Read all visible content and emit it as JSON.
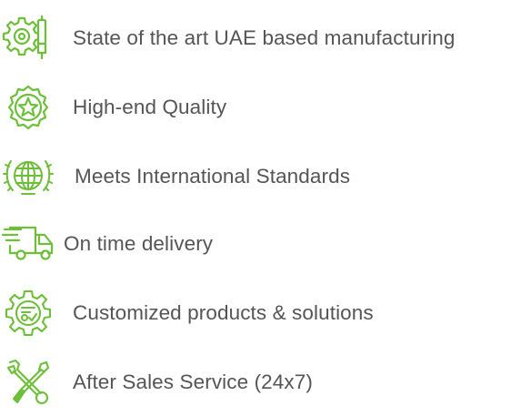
{
  "accent_color": "#6dbf3a",
  "text_color": "#555555",
  "features": [
    {
      "icon": "manufacturing-gear-icon",
      "label": "State of the art UAE based manufacturing"
    },
    {
      "icon": "quality-badge-icon",
      "label": "High-end Quality"
    },
    {
      "icon": "globe-laurel-icon",
      "label": "Meets International Standards"
    },
    {
      "icon": "delivery-truck-icon",
      "label": "On time delivery"
    },
    {
      "icon": "customization-gear-icon",
      "label": "Customized products & solutions"
    },
    {
      "icon": "tools-icon",
      "label": "After Sales Service (24x7)"
    }
  ]
}
